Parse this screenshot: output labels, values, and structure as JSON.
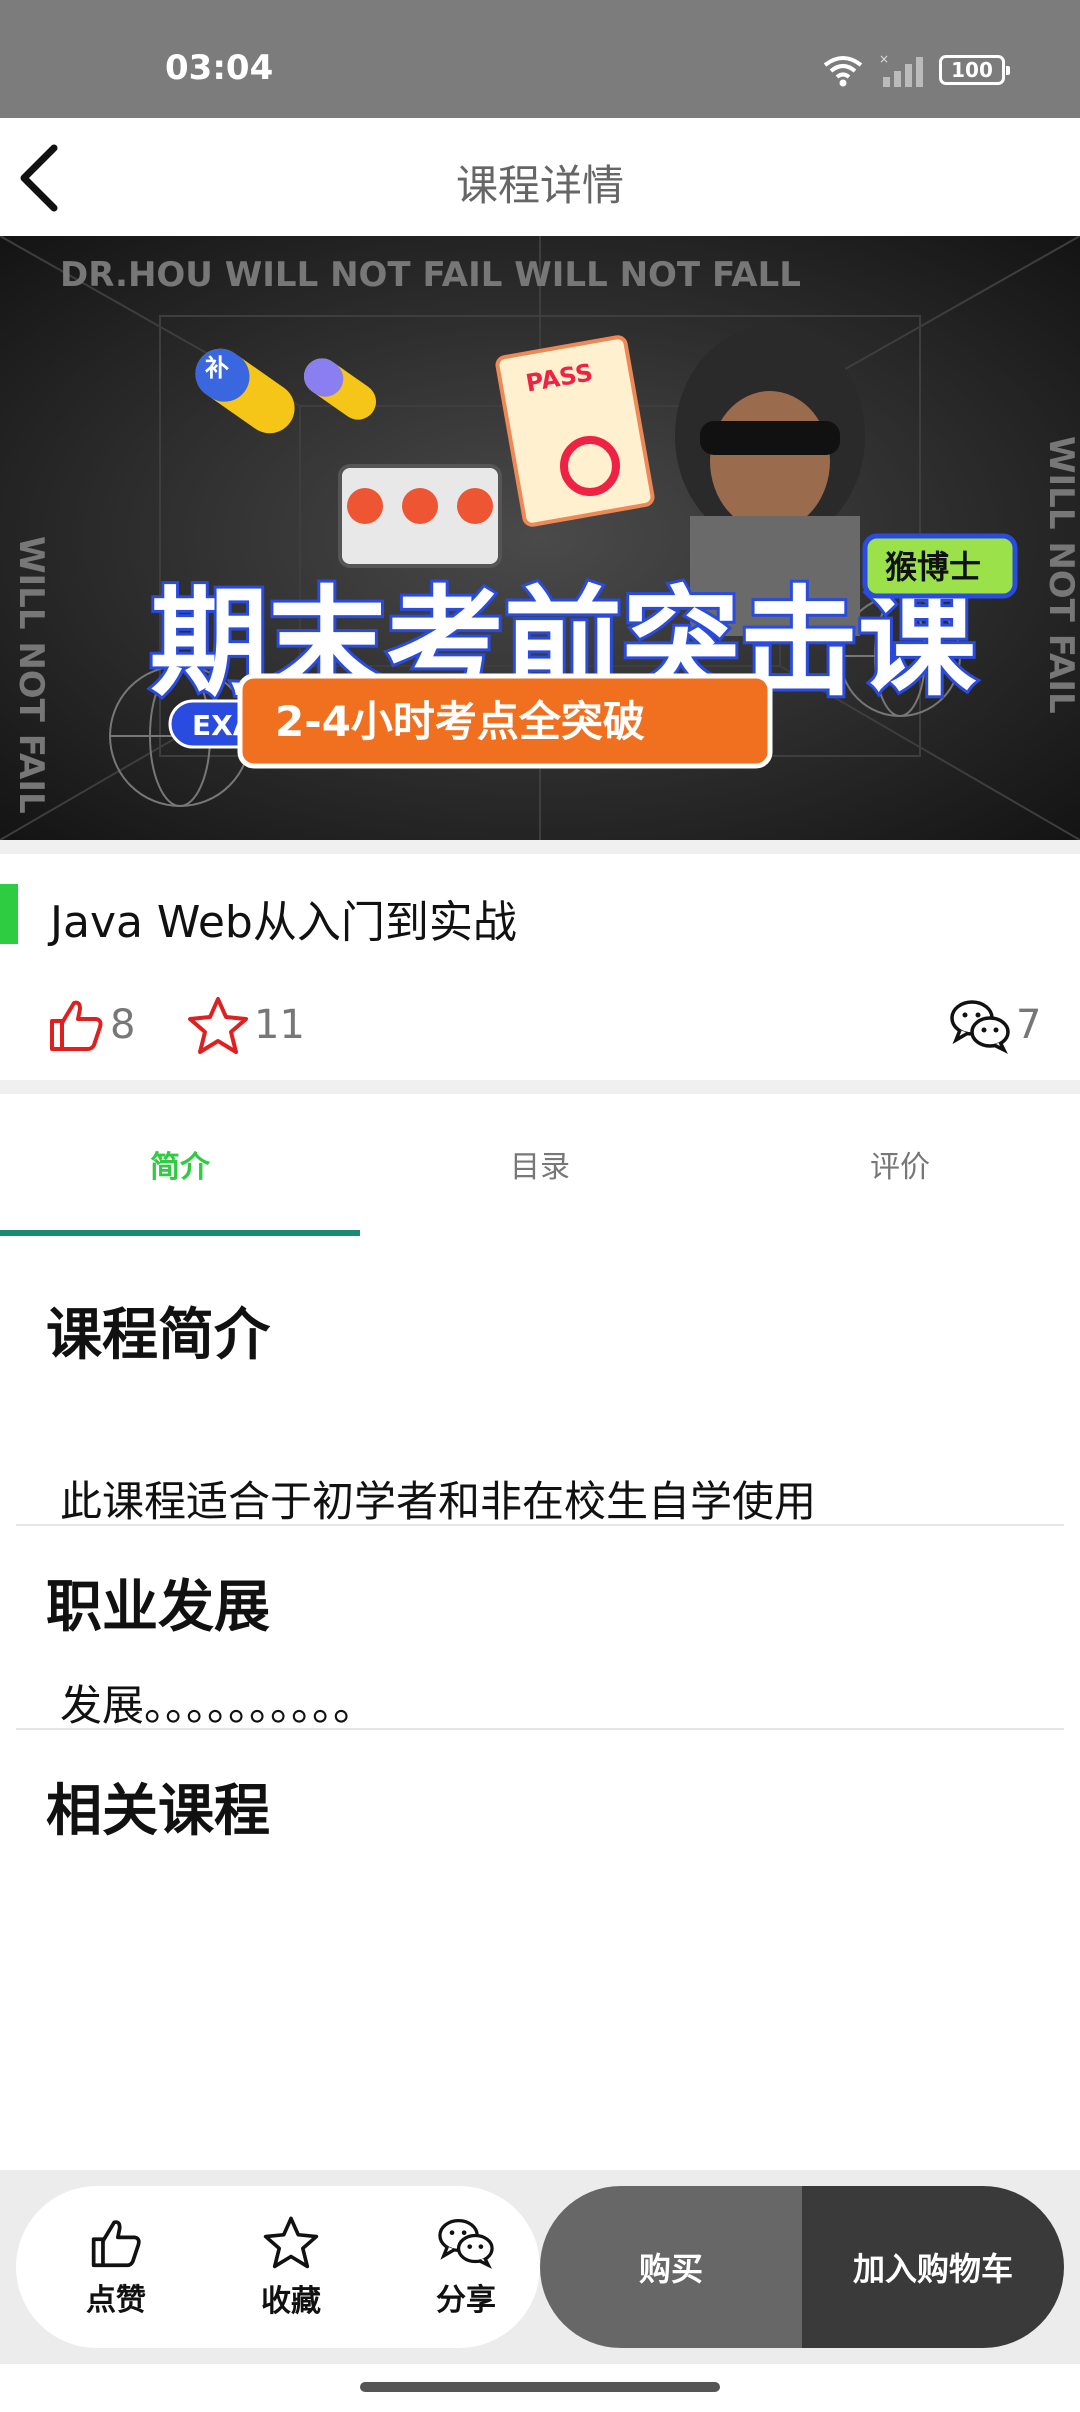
{
  "status": {
    "time": "03:04",
    "battery": "100"
  },
  "header": {
    "title": "课程详情"
  },
  "banner": {
    "top_marquee": "DR.HOU WILL NOT FAIL WILL NOT FALL",
    "side_marquee": "WILL NOT FAIL",
    "headline": "期末考前突击课",
    "exam_tag": "EXAM",
    "pass_tag": "PASS",
    "brand_tag": "猴博士",
    "subline": "2-4小时考点全突破",
    "pill_char": "补"
  },
  "course": {
    "title": "Java Web从入门到实战",
    "likes": "8",
    "favorites": "11",
    "comments": "7"
  },
  "tabs": [
    "简介",
    "目录",
    "评价"
  ],
  "sections": {
    "intro_heading": "课程简介",
    "intro_text": "此课程适合于初学者和非在校生自学使用",
    "career_heading": "职业发展",
    "career_text": "发展。。。。。。。。。。",
    "related_heading": "相关课程"
  },
  "bottom_bar": {
    "like_label": "点赞",
    "favorite_label": "收藏",
    "share_label": "分享",
    "buy_label": "购买",
    "cart_label": "加入购物车"
  },
  "colors": {
    "accent": "#2ecc40",
    "tab_indicator": "#1b8a72",
    "icon_red": "#e02020"
  }
}
